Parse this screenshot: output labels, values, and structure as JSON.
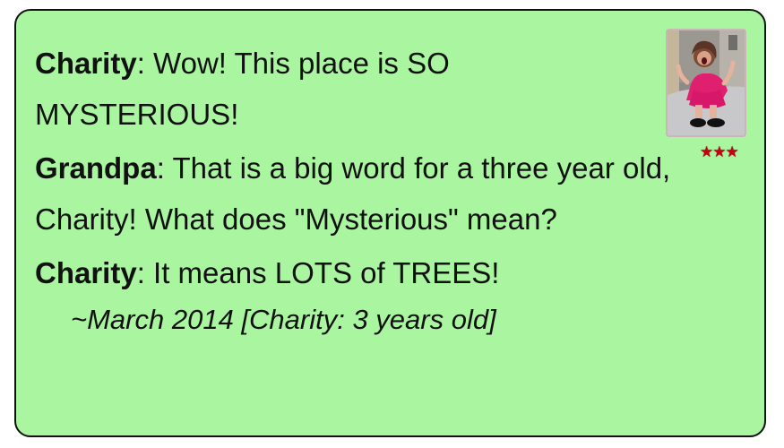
{
  "dialogue": [
    {
      "speaker": "Charity",
      "text": ": Wow! This place is SO MYSTERIOUS!"
    },
    {
      "speaker": "Grandpa",
      "text": ": That is a big word for a three year old, Charity! What does \"Mysterious\" mean?"
    },
    {
      "speaker": "Charity",
      "text": ": It means LOTS of TREES!"
    }
  ],
  "caption": "~March 2014 [Charity: 3 years old]",
  "rating": {
    "stars": 3,
    "max": 3,
    "display": "★★★"
  },
  "photo": {
    "subject": "child-in-pink-dress-photo"
  },
  "colors": {
    "card_background": "#aaf5a0",
    "card_border": "#111111",
    "star": "#c40012",
    "dress": "#e0206f"
  }
}
